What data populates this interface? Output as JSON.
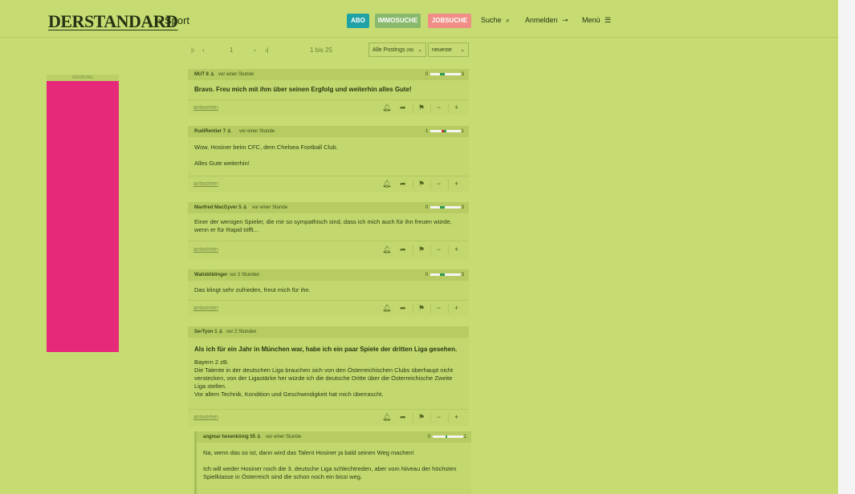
{
  "header": {
    "logo": "DERSTANDARD",
    "section": "› Sport",
    "abo": "ABO",
    "immo": "IMMOSUCHE",
    "job": "JOBSUCHE",
    "search_label": "Suche",
    "login_label": "Anmelden",
    "menu_label": "Menü",
    "colors": {
      "abo": "#1fa2a6",
      "immo": "#89b96d",
      "job": "#ef8d86",
      "page": "#c6dc72"
    }
  },
  "ad": {
    "label": "WERBUNG",
    "color": "#e62a79"
  },
  "pager": {
    "first": "|‹",
    "prev": "‹",
    "page": "1",
    "next": "›",
    "last": "›|",
    "range": "1 bis 25",
    "filter": "Alle Postings",
    "filter_count": "(68)",
    "sort": "neueste"
  },
  "posts": [
    {
      "user": "MUT",
      "count": "8",
      "time": "vor einer Stunde",
      "vote_left": "0",
      "vote_right": "3",
      "title": "Bravo. Freu mich mit ihm über seinen Ergfolg und weiterhin alles Gute!",
      "body": "",
      "reply": "antworten"
    },
    {
      "user": "RudiRentier",
      "count": "7",
      "time": "vor einer Stunde",
      "vote_left": "1",
      "vote_right": "1",
      "title": "",
      "body": "Wow, Hosiner beim CFC, dem Chelsea Football Club.\n\nAlles Gute weiterhin!",
      "reply": "antworten"
    },
    {
      "user": "Manfred MacGyver",
      "count": "5",
      "time": "vor einer Stunde",
      "vote_left": "0",
      "vote_right": "3",
      "title": "",
      "body": "Einer der wenigen Spieler, die mir so sympathisch sind, dass ich mich auch für ihn freuen würde, wenn er für Rapid trifft...",
      "reply": "antworten"
    },
    {
      "user": "Wahldöblinger",
      "count": "",
      "time": "vor 2 Stunden",
      "vote_left": "0",
      "vote_right": "3",
      "title": "",
      "body": "Das klingt sehr zufrieden, freut mich für ihn.",
      "reply": "antworten"
    },
    {
      "user": "SerTyon",
      "count": "1",
      "time": "vor 2 Stunden",
      "vote_left": "",
      "vote_right": "",
      "title": "Als ich für ein Jahr in München war, habe ich ein paar Spiele der dritten Liga gesehen.",
      "body": "Bayern 2 zB.\nDie Talente in der deutschen Liga brauchen sich von den Österreichischen Clubs überhaupt nicht verstecken, von der Ligastärke her würde ich die deutsche Dritte über die Österreichische Zweite Liga stellen.\nVor allem Technik, Kondition und Geschwindigkeit hat mich überrascht.",
      "reply": "antworten"
    },
    {
      "user": "angmar hexenkönig",
      "count": "55",
      "time": "vor einer Stunde",
      "vote_left": "0",
      "vote_right": "1",
      "title": "",
      "body": "Na, wenn das so ist, dann wird das Talent Hosiner ja bald seinen Weg machen!\n\nIch will weder Hosiner noch die 3. deutsche Liga schlechtreden, aber vom Niveau der höchsten Spielklasse in Österreich sind die schon noch ein bissi weg.",
      "reply": ""
    }
  ],
  "icons": {
    "bell": "bell-icon",
    "share": "share-icon",
    "flag": "flag-icon",
    "minus": "minus-icon",
    "plus": "plus-icon"
  }
}
